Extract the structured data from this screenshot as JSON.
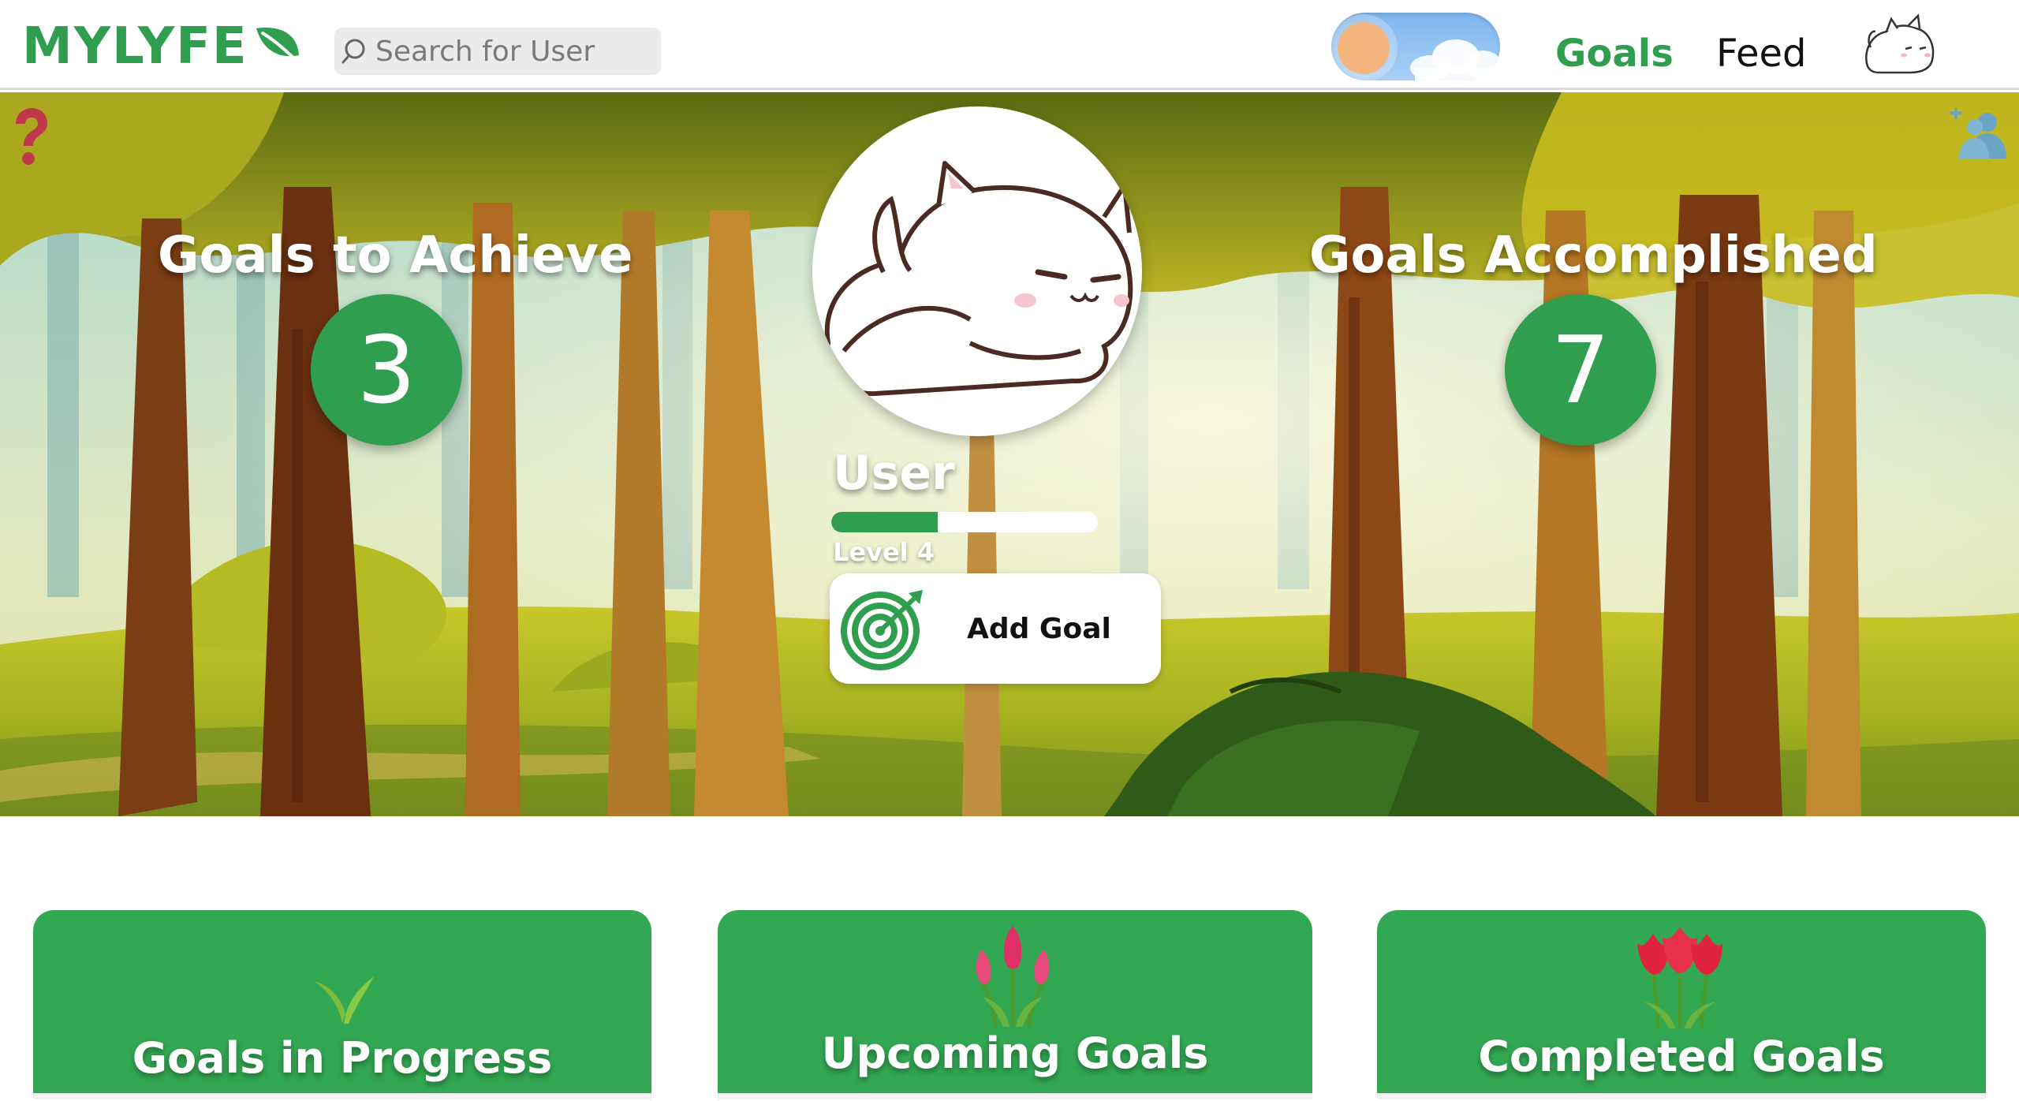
{
  "app": {
    "logo_text": "MYLYFE",
    "brand_color": "#2f9e4f"
  },
  "search": {
    "placeholder": "Search for User"
  },
  "nav": {
    "goals_label": "Goals",
    "feed_label": "Feed",
    "theme_toggle_state": "light"
  },
  "hero": {
    "goals_to_achieve": {
      "title": "Goals to Achieve",
      "count": "3"
    },
    "goals_accomplished": {
      "title": "Goals Accomplished",
      "count": "7"
    },
    "user": {
      "name": "User",
      "level_label": "Level 4",
      "xp_progress": 0.4
    },
    "add_goal_label": "Add Goal"
  },
  "cards": [
    {
      "title": "Goals in Progress",
      "icon": "sprout-icon"
    },
    {
      "title": "Upcoming Goals",
      "icon": "tulip-bud-icon"
    },
    {
      "title": "Completed Goals",
      "icon": "tulip-bloom-icon"
    }
  ],
  "colors": {
    "accent_green": "#2f9e4f",
    "card_green": "#33a853",
    "help_red": "#c0394b",
    "friends_blue": "#6aa6c4"
  }
}
